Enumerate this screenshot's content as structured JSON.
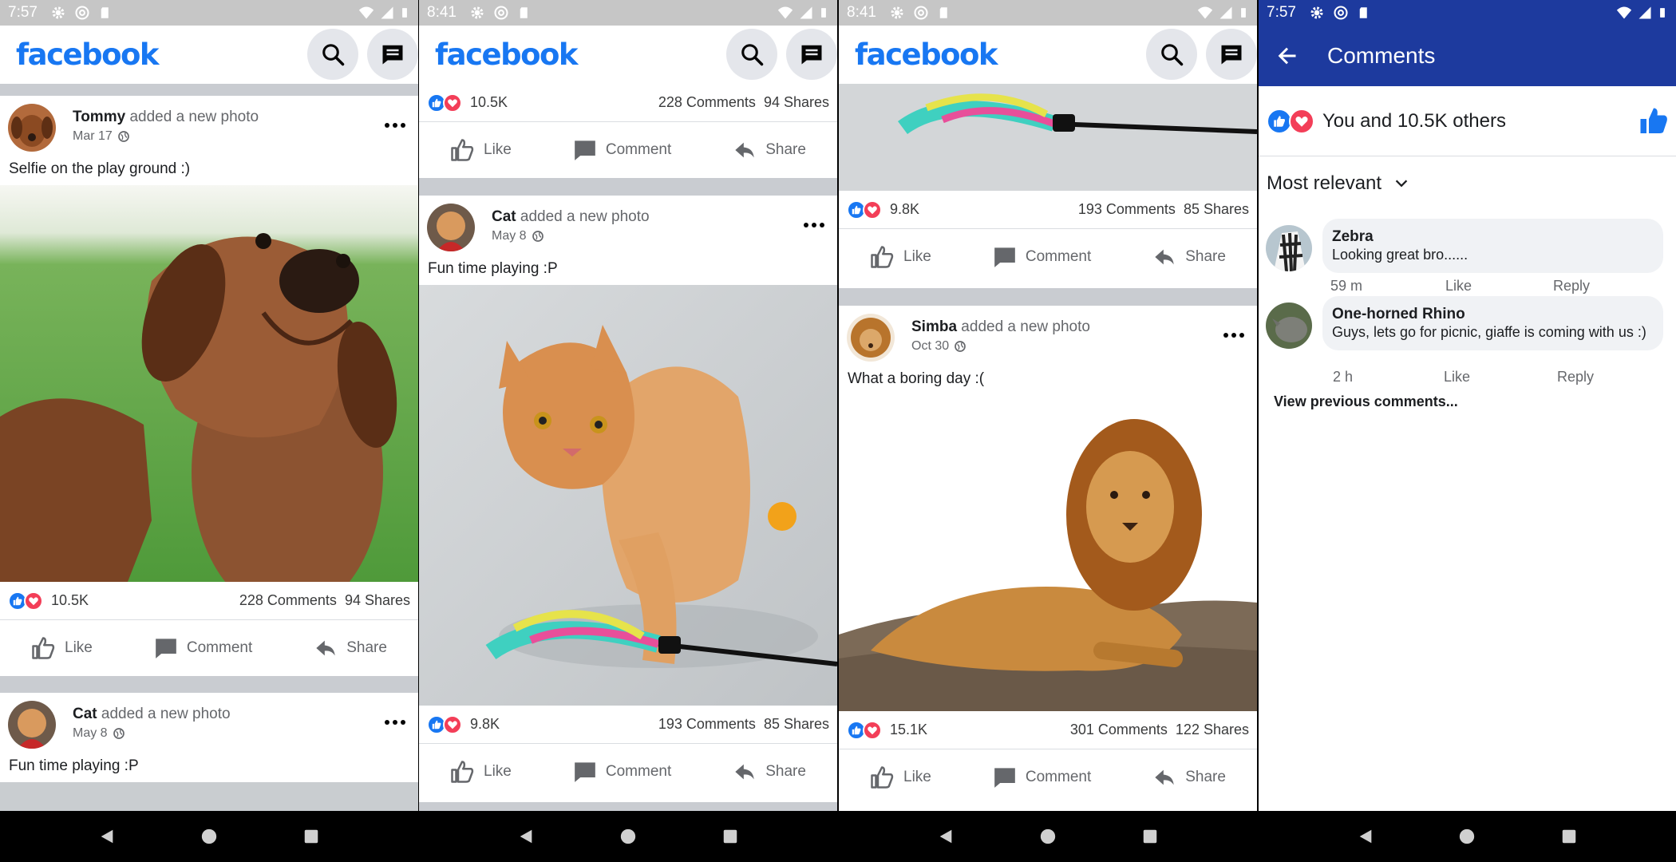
{
  "statusbars": [
    {
      "time": "7:57"
    },
    {
      "time": "8:41"
    },
    {
      "time": "8:41"
    },
    {
      "time": "7:57"
    }
  ],
  "appbar": {
    "logo": "facebook"
  },
  "action_labels": {
    "like": "Like",
    "comment": "Comment",
    "share": "Share"
  },
  "phone1": {
    "post1": {
      "name": "Tommy",
      "action": " added a new photo",
      "date": "Mar 17",
      "text": "Selfie on the play ground :)",
      "reactions": "10.5K",
      "comments": "228 Comments",
      "shares": "94 Shares"
    },
    "post2": {
      "name": "Cat",
      "action": " added a new photo",
      "date": "May 8",
      "text": "Fun time playing :P"
    }
  },
  "phone2": {
    "top_stats": {
      "reactions": "10.5K",
      "comments": "228 Comments",
      "shares": "94 Shares"
    },
    "post": {
      "name": "Cat",
      "action": " added a new photo",
      "date": "May 8",
      "text": "Fun time playing :P",
      "reactions": "9.8K",
      "comments": "193 Comments",
      "shares": "85 Shares"
    }
  },
  "phone3": {
    "top_stats": {
      "reactions": "9.8K",
      "comments": "193 Comments",
      "shares": "85 Shares"
    },
    "post": {
      "name": "Simba",
      "action": " added a new photo",
      "date": "Oct 30",
      "text": "What a boring day :(",
      "reactions": "15.1K",
      "comments": "301 Comments",
      "shares": "122 Shares"
    }
  },
  "comments_screen": {
    "title": "Comments",
    "reacted_text": "You and 10.5K others",
    "sort_label": "Most relevant",
    "comments": [
      {
        "name": "Zebra",
        "text": "Looking great bro......",
        "time": "59 m",
        "like": "Like",
        "reply": "Reply"
      },
      {
        "name": "One-horned Rhino",
        "text": "Guys, lets go for picnic, giaffe is coming with us :)",
        "time": "2 h",
        "like": "Like",
        "reply": "Reply"
      }
    ],
    "view_previous": "View previous comments..."
  },
  "colors": {
    "brand": "#1877f2",
    "comments_bar": "#1d3a9e",
    "love": "#f33e58"
  },
  "icons": [
    "search-icon",
    "messenger-icon",
    "more-icon",
    "globe-icon",
    "like-icon",
    "comment-icon",
    "share-icon",
    "back-arrow-icon",
    "thumbs-up-icon",
    "chevron-down-icon",
    "nav-back-icon",
    "nav-home-icon",
    "nav-recents-icon"
  ]
}
